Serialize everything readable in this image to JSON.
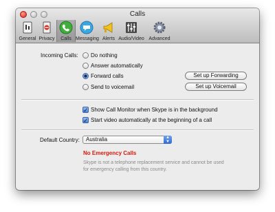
{
  "window": {
    "title": "Calls"
  },
  "toolbar": {
    "items": [
      {
        "label": "General",
        "icon": "general-icon"
      },
      {
        "label": "Privacy",
        "icon": "privacy-icon"
      },
      {
        "label": "Calls",
        "icon": "calls-icon",
        "selected": true
      },
      {
        "label": "Messaging",
        "icon": "messaging-icon"
      },
      {
        "label": "Alerts",
        "icon": "alerts-icon"
      },
      {
        "label": "Audio/Video",
        "icon": "audio-video-icon"
      },
      {
        "label": "Advanced",
        "icon": "advanced-icon"
      }
    ]
  },
  "incoming": {
    "label": "Incoming Calls:",
    "options": [
      {
        "label": "Do nothing",
        "selected": false
      },
      {
        "label": "Answer automatically",
        "selected": false
      },
      {
        "label": "Forward calls",
        "selected": true
      },
      {
        "label": "Send to voicemail",
        "selected": false
      }
    ],
    "forwarding_button": "Set up Forwarding",
    "voicemail_button": "Set up Voicemail"
  },
  "checkboxes": [
    {
      "label": "Show Call Monitor when Skype is in the background",
      "checked": true
    },
    {
      "label": "Start video automatically at the beginning of a call",
      "checked": true
    }
  ],
  "country": {
    "label": "Default Country:",
    "value": "Australia",
    "warning": "No Emergency Calls",
    "note_line1": "Skype is not a telephone replacement service and cannot be used",
    "note_line2": "for emergency calling from this country."
  },
  "colors": {
    "warning": "#d41a0a",
    "accent": "#3a62a7"
  }
}
